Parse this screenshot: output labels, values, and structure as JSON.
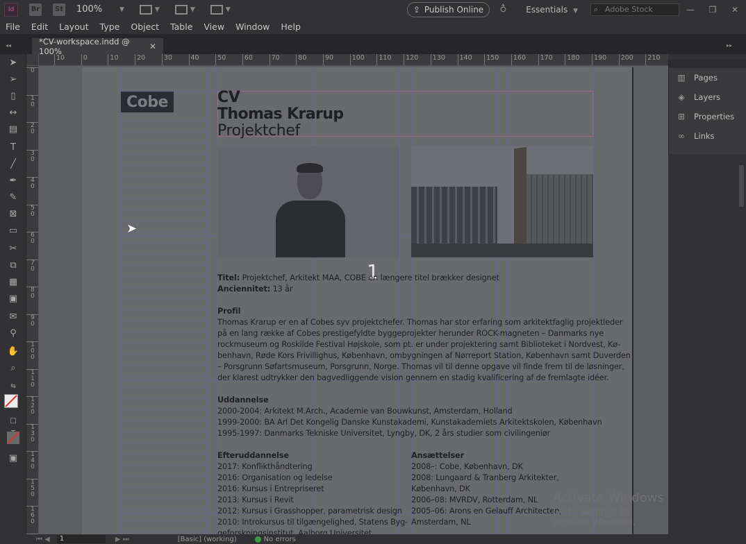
{
  "appbar": {
    "logo": "Id",
    "bridge": "Br",
    "stock_btn": "St",
    "zoom": "100%",
    "publish_label": "Publish Online",
    "workspace": "Essentials",
    "search_placeholder": "Adobe Stock"
  },
  "menu": [
    "File",
    "Edit",
    "Layout",
    "Type",
    "Object",
    "Table",
    "View",
    "Window",
    "Help"
  ],
  "doc_tab": {
    "title": "*CV-workspace.indd @ 100%"
  },
  "hruler_ticks": [
    "10",
    "0",
    "10",
    "20",
    "30",
    "40",
    "50",
    "60",
    "70",
    "80",
    "90",
    "100",
    "110",
    "120",
    "130",
    "140",
    "150",
    "160",
    "170",
    "180",
    "190",
    "200",
    "210",
    "22"
  ],
  "vruler_ticks": [
    "0",
    "10",
    "20",
    "30",
    "40",
    "50",
    "60",
    "70",
    "80",
    "90",
    "100",
    "110",
    "120",
    "130",
    "140",
    "150",
    "160",
    "170"
  ],
  "document": {
    "logo": "Cobe",
    "title": "CV",
    "name": "Thomas Krarup",
    "role": "Projektchef",
    "page_number": "1",
    "titel_label": "Titel:",
    "titel_value": " Projektchef, Arkitekt MAA, COBE en længere titel brækker designet",
    "anc_label": "Anciennitet:",
    "anc_value": " 13 år",
    "profil_heading": "Profil",
    "profil_lines": [
      "Thomas Krarup er en af Cobes syv projektchefer. Thomas har stor erfaring som arkitektfaglig projektleder",
      "på en lang række af Cobes prestigefyldte byggeprojekter herunder ROCK-magneten – Danmarks nye",
      "rockmuseum og Roskilde Festival Højskole, som pt. er under projektering samt Biblioteket i Nordvest, Kø-",
      "benhavn, Røde Kors Frivillighus, København, ombygningen af Nørreport Station, København samt Duverden",
      "– Porsgrunn Søfartsmuseum, Porsgrunn, Norge. Thomas vil til denne opgave vil finde frem til de løsninger,",
      "der klarest udtrykker den bagvedliggende vision gennem en stadig kvalificering af de fremlagte idéer."
    ],
    "uddannelse_heading": "Uddannelse",
    "uddannelse_lines": [
      "2000-2004: Arkitekt M.Arch., Academie van Bouwkunst, Amsterdam, Holland",
      "1999-2000: BA Arl Det Kongelig Danske Kunstakademi, Kunstakademiets Arkitektskolen, København",
      "1995-1997: Danmarks Tekniske Universitet, Lyngby, DK, 2 års studier som civilingeniør"
    ],
    "efter_heading": "Efteruddannelse",
    "efter_lines": [
      "2017: Konflikthåndtering",
      "2016: Organisation og ledelse",
      "2016: Kursus i Entrepriseret",
      "2013: Kursus i Revit",
      "2012: Kursus i Grasshopper, parametrisk design",
      "2010: Introkursus til tilgængelighed, Statens Byg-",
      "geforskningsinstitut, Aalborg Universitet"
    ],
    "ansat_heading": "Ansættelser",
    "ansat_lines": [
      "2008–: Cobe, København, DK",
      "2008: Lungaard & Tranberg Arkitekter,",
      "København, DK",
      "2006–08: MVRDV, Rotterdam, NL",
      "2005–06: Arons en Gelauff Architecten,",
      "Amsterdam, NL"
    ]
  },
  "panels": [
    "Pages",
    "Layers",
    "Properties",
    "Links"
  ],
  "watermark": {
    "line1": "Activate Windows",
    "line2": "Go to Settings to activate Windows."
  },
  "statusbar": {
    "page": "1",
    "style": "[Basic] (working)",
    "errors": "No errors"
  }
}
